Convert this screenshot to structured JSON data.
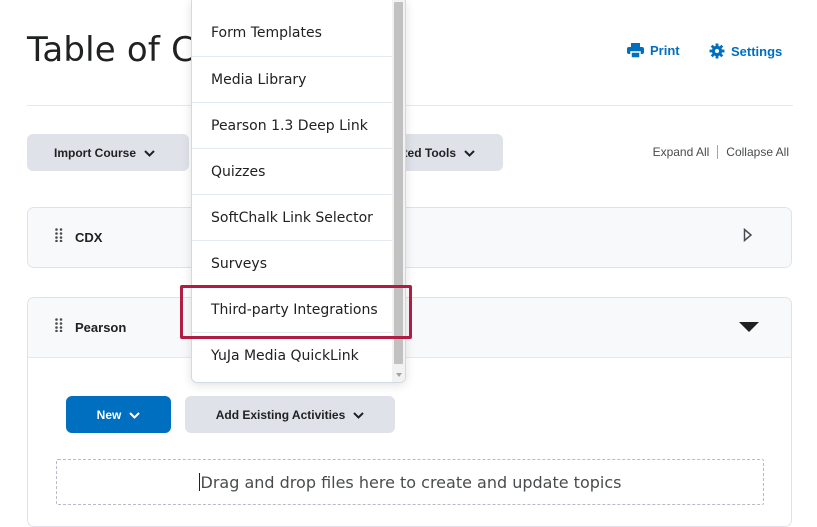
{
  "page": {
    "title": "Table of Contents"
  },
  "header": {
    "print_label": "Print",
    "settings_label": "Settings"
  },
  "toolbar": {
    "import_course_label": "Import Course",
    "related_tools_label": "Related Tools",
    "expand_all_label": "Expand All",
    "collapse_all_label": "Collapse All"
  },
  "modules": [
    {
      "title": "CDX"
    },
    {
      "title": "Pearson"
    }
  ],
  "module_actions": {
    "new_label": "New",
    "add_existing_label": "Add Existing Activities",
    "dropzone_text": "Drag and drop files here to create and update topics"
  },
  "menu": {
    "items": [
      {
        "label": "Form Templates"
      },
      {
        "label": "Media Library"
      },
      {
        "label": "Pearson 1.3 Deep Link"
      },
      {
        "label": "Quizzes"
      },
      {
        "label": "SoftChalk Link Selector"
      },
      {
        "label": "Surveys"
      },
      {
        "label": "Third-party Integrations"
      },
      {
        "label": "YuJa Media QuickLink"
      }
    ],
    "highlighted_item": "Third-party Integrations"
  },
  "colors": {
    "accent": "#006fbf",
    "highlight_border": "#b01c43",
    "button_gray": "#dfe3e9"
  },
  "icons": [
    "print-icon",
    "gear-icon",
    "chevron-down-icon",
    "drag-handle-icon",
    "caret-right-icon",
    "caret-down-icon"
  ]
}
